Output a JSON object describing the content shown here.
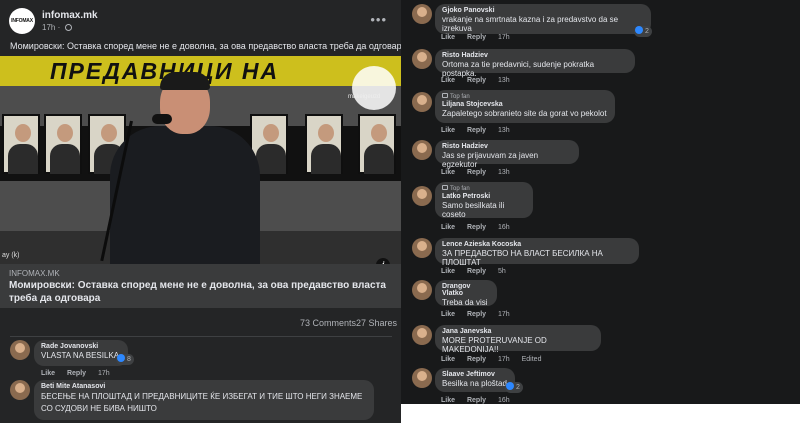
{
  "post": {
    "page_name": "infomax.mk",
    "page_logo_text": "INFOMAX",
    "time": "17h",
    "text": "Момировски: Оставка според мене не е доволна, за ова предавство власта треба да одговара",
    "image": {
      "banner_text": "ПРЕДАВНИЦИ НА",
      "watermark_text": "makeigeuzd",
      "corner_label": "ay (k)"
    },
    "link": {
      "domain": "INFOMAX.MK",
      "title": "Момировски: Оставка според мене не е доволна, за ова предавство власта треба да одговара"
    },
    "comments_count": "73 Comments",
    "shares_count": "27 Shares",
    "comments": [
      {
        "name": "Rade Jovanovski",
        "text": "VLASTA NA BESILKA",
        "like": "Like",
        "reply": "Reply",
        "time": "17h",
        "reactions": "8"
      },
      {
        "name": "Beti Mite Atanasovi",
        "text": "БЕСЕЊЕ НА ПЛОШТАД И ПРЕДАВНИЦИТЕ ЌЕ ИЗБЕГАТ И ТИЕ ШТО НЕГИ ЗНАЕМЕ СО СУДОВИ НЕ БИВА НИШТО"
      }
    ]
  },
  "right_comments": [
    {
      "name": "Gjoko Panovski",
      "text": "vrakanje na smrtnata kazna i za predavstvo da se izrekuva",
      "like": "Like",
      "reply": "Reply",
      "time": "17h",
      "reactions": "2"
    },
    {
      "name": "Risto Hadziev",
      "text": "Ortoma za tie predavnici, sudenje pokratka postapka.",
      "like": "Like",
      "reply": "Reply",
      "time": "13h"
    },
    {
      "top_fan": "Top fan",
      "name": "Liljana Stojcevska",
      "text": "Zapaletego sobranieto site da gorat vo pekolot",
      "like": "Like",
      "reply": "Reply",
      "time": "13h"
    },
    {
      "name": "Risto Hadziev",
      "text": "Jas se prijavuvam za javen egzekutor",
      "like": "Like",
      "reply": "Reply",
      "time": "13h"
    },
    {
      "top_fan": "Top fan",
      "name": "Latko Petroski",
      "text": "Samo besilkata ili coseto",
      "like": "Like",
      "reply": "Reply",
      "time": "16h"
    },
    {
      "name": "Lence Azieska Kocoska",
      "text": "ЗА ПРЕДАВСТВО НА ВЛАСТ БЕСИЛКА НА ПЛОШТАТ",
      "like": "Like",
      "reply": "Reply",
      "time": "5h"
    },
    {
      "name": "Drangov Vlatko",
      "text": "Treba da visi",
      "like": "Like",
      "reply": "Reply",
      "time": "17h"
    },
    {
      "name": "Jana Janevska",
      "text": "MORE PROTERUVANJE OD MAKEDONIJA!!",
      "like": "Like",
      "reply": "Reply",
      "time": "17h",
      "edited": "Edited"
    },
    {
      "name": "Slaave Jeftimov",
      "text": "Besilka na ploštad",
      "like": "Like",
      "reply": "Reply",
      "time": "16h",
      "reactions": "2"
    }
  ]
}
